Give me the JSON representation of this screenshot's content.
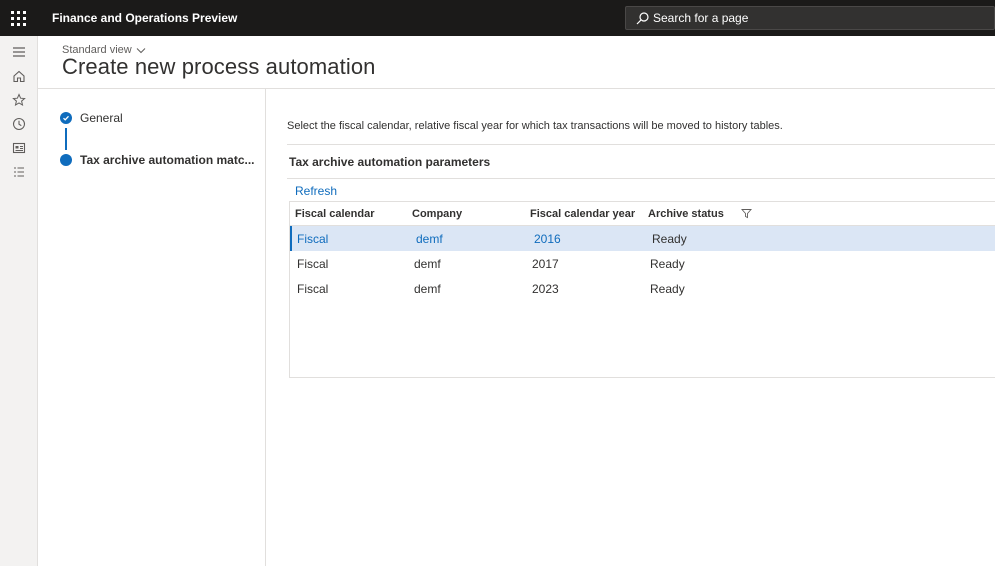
{
  "app": {
    "name": "Finance and Operations Preview"
  },
  "search": {
    "placeholder": "Search for a page"
  },
  "navrail": {
    "icons": [
      "hamburger-icon",
      "home-icon",
      "star-icon",
      "clock-icon",
      "workspace-icon",
      "list-icon"
    ]
  },
  "header": {
    "view": "Standard view",
    "title": "Create new process automation"
  },
  "steps": [
    {
      "label": "General",
      "state": "completed"
    },
    {
      "label": "Tax archive automation matc...",
      "state": "current"
    }
  ],
  "content": {
    "instruction": "Select the fiscal calendar, relative fiscal year for which tax transactions will be moved to history tables.",
    "section_title": "Tax archive automation parameters",
    "refresh_label": "Refresh"
  },
  "grid": {
    "columns": [
      "Fiscal calendar",
      "Company",
      "Fiscal calendar year",
      "Archive status"
    ],
    "rows": [
      [
        "Fiscal",
        "demf",
        "2016",
        "Ready"
      ],
      [
        "Fiscal",
        "demf",
        "2017",
        "Ready"
      ],
      [
        "Fiscal",
        "demf",
        "2023",
        "Ready"
      ]
    ],
    "selected_row": 0
  },
  "colors": {
    "accent": "#0f6cbd",
    "topbar": "#1b1a19",
    "selected_row": "#dbe6f5"
  }
}
